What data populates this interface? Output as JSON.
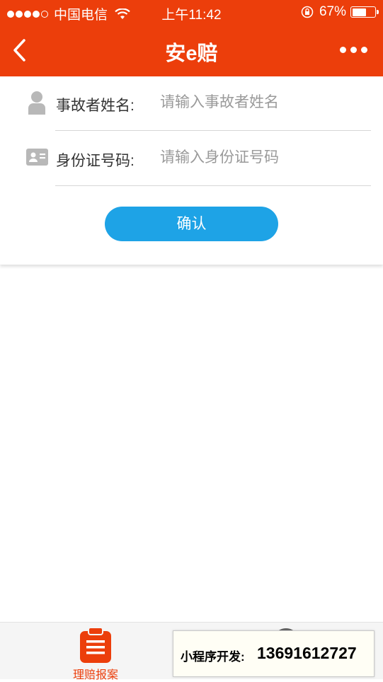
{
  "status_bar": {
    "carrier": "中国电信",
    "time": "上午11:42",
    "battery_percent": "67%",
    "battery_level": 0.67
  },
  "nav": {
    "title": "安e赔"
  },
  "form": {
    "name_label": "事故者姓名:",
    "name_placeholder": "请输入事故者姓名",
    "id_label": "身份证号码:",
    "id_placeholder": "请输入身份证号码",
    "confirm_label": "确认"
  },
  "tab_bar": {
    "claim_label": "理赔报案"
  },
  "overlay": {
    "label": "小程序开发:",
    "phone": "13691612727"
  },
  "colors": {
    "brand": "#ec3e0b",
    "button": "#1ea3e6"
  }
}
